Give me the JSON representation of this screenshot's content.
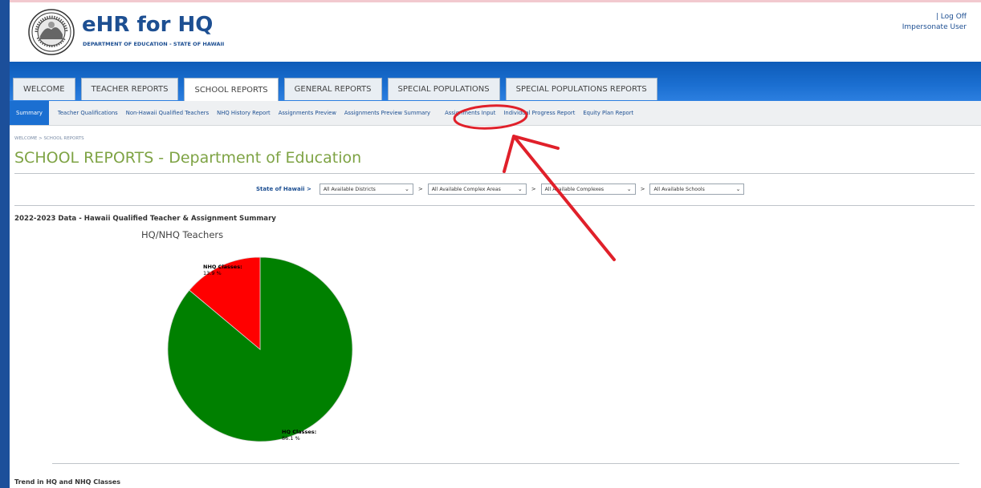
{
  "header": {
    "app_title": "eHR for HQ",
    "app_subtitle": "DEPARTMENT OF EDUCATION - STATE OF HAWAII",
    "log_off": "| Log Off",
    "impersonate": "Impersonate User"
  },
  "tabs": [
    {
      "label": "WELCOME"
    },
    {
      "label": "TEACHER REPORTS"
    },
    {
      "label": "SCHOOL REPORTS",
      "active": true
    },
    {
      "label": "GENERAL REPORTS"
    },
    {
      "label": "SPECIAL POPULATIONS"
    },
    {
      "label": "SPECIAL POPULATIONS REPORTS"
    }
  ],
  "subnav": [
    {
      "label": "Summary",
      "active": true
    },
    {
      "label": "Teacher Qualifications"
    },
    {
      "label": "Non-Hawaii Qualified Teachers"
    },
    {
      "label": "NHQ History Report"
    },
    {
      "label": "Assignments Preview"
    },
    {
      "label": "Assignments Preview Summary"
    },
    {
      "label": "Assignments Input"
    },
    {
      "label": "Individual Progress Report"
    },
    {
      "label": "Equity Plan Report"
    }
  ],
  "breadcrumb": "WELCOME > SCHOOL REPORTS",
  "page_title": "SCHOOL REPORTS - Department of Education",
  "filters": {
    "state_label": "State of Hawaii >",
    "districts": "All Available Districts",
    "complex_areas": "All Available Complex Areas",
    "complexes": "All Available Complexes",
    "schools": "All Available Schools",
    "separator": ">"
  },
  "section_title": "2022-2023 Data - Hawaii Qualified Teacher & Assignment Summary",
  "trend_title": "Trend in HQ and NHQ Classes",
  "colors": {
    "brand_blue": "#1d4f92",
    "title_green": "#7ea344",
    "hq_green": "#008000",
    "nhq_red": "#ff0000",
    "annotation_red": "#e0202a"
  },
  "chart_data": {
    "type": "pie",
    "title": "HQ/NHQ Teachers",
    "slices": [
      {
        "label": "HQ Classes:",
        "value": 86.1,
        "display": "86.1 %",
        "color": "#008000"
      },
      {
        "label": "NHQ Classes:",
        "value": 13.9,
        "display": "13.9 %",
        "color": "#ff0000"
      }
    ]
  }
}
